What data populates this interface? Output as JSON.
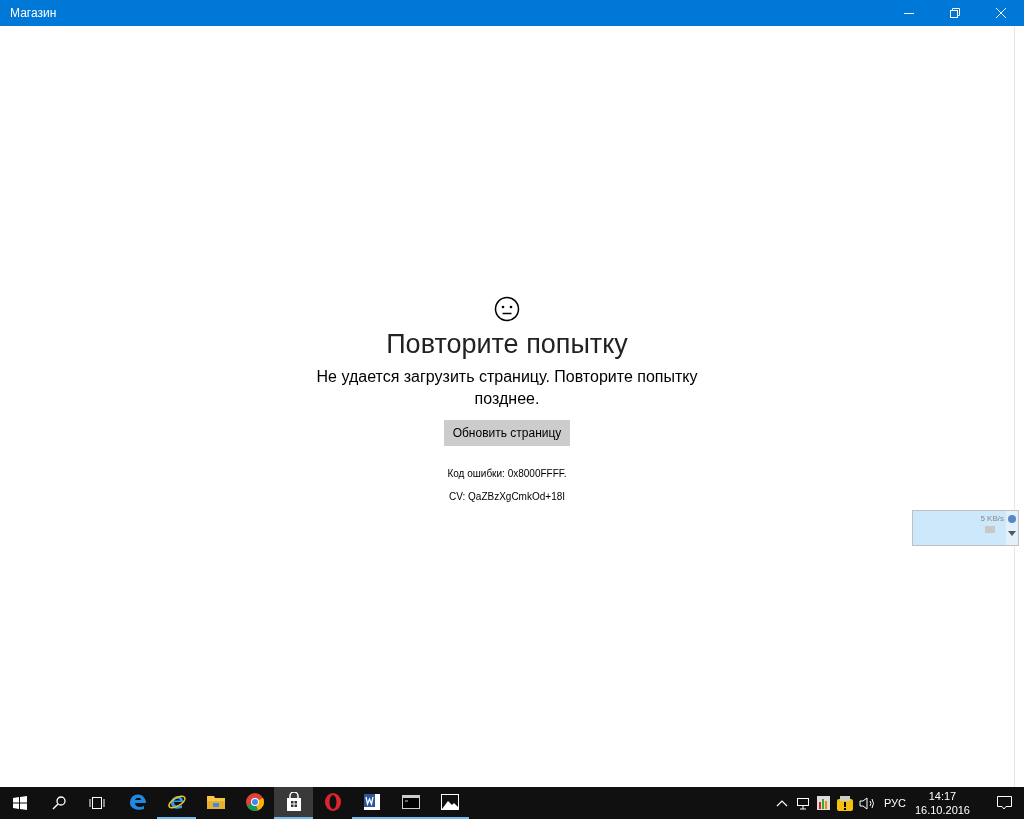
{
  "window": {
    "title": "Магазин"
  },
  "error": {
    "heading": "Повторите попытку",
    "message": "Не удается загрузить страницу. Повторите попытку позднее.",
    "button": "Обновить страницу",
    "code": "Код ошибки: 0x8000FFFF.",
    "cv": "CV: QaZBzXgCmkOd+18I"
  },
  "speed_widget": {
    "reading": "5 KB/s"
  },
  "taskbar": {
    "apps": [
      {
        "kind": "edge",
        "running": false,
        "selected": false
      },
      {
        "kind": "ie",
        "running": true,
        "selected": false
      },
      {
        "kind": "folder",
        "running": false,
        "selected": false
      },
      {
        "kind": "chrome",
        "running": false,
        "selected": false
      },
      {
        "kind": "store",
        "running": true,
        "selected": true
      },
      {
        "kind": "opera",
        "running": false,
        "selected": false
      },
      {
        "kind": "word",
        "running": true,
        "selected": false
      },
      {
        "kind": "console",
        "running": true,
        "selected": false
      },
      {
        "kind": "photos",
        "running": true,
        "selected": false
      }
    ],
    "language": "РУС",
    "time": "14:17",
    "date": "16.10.2016"
  }
}
